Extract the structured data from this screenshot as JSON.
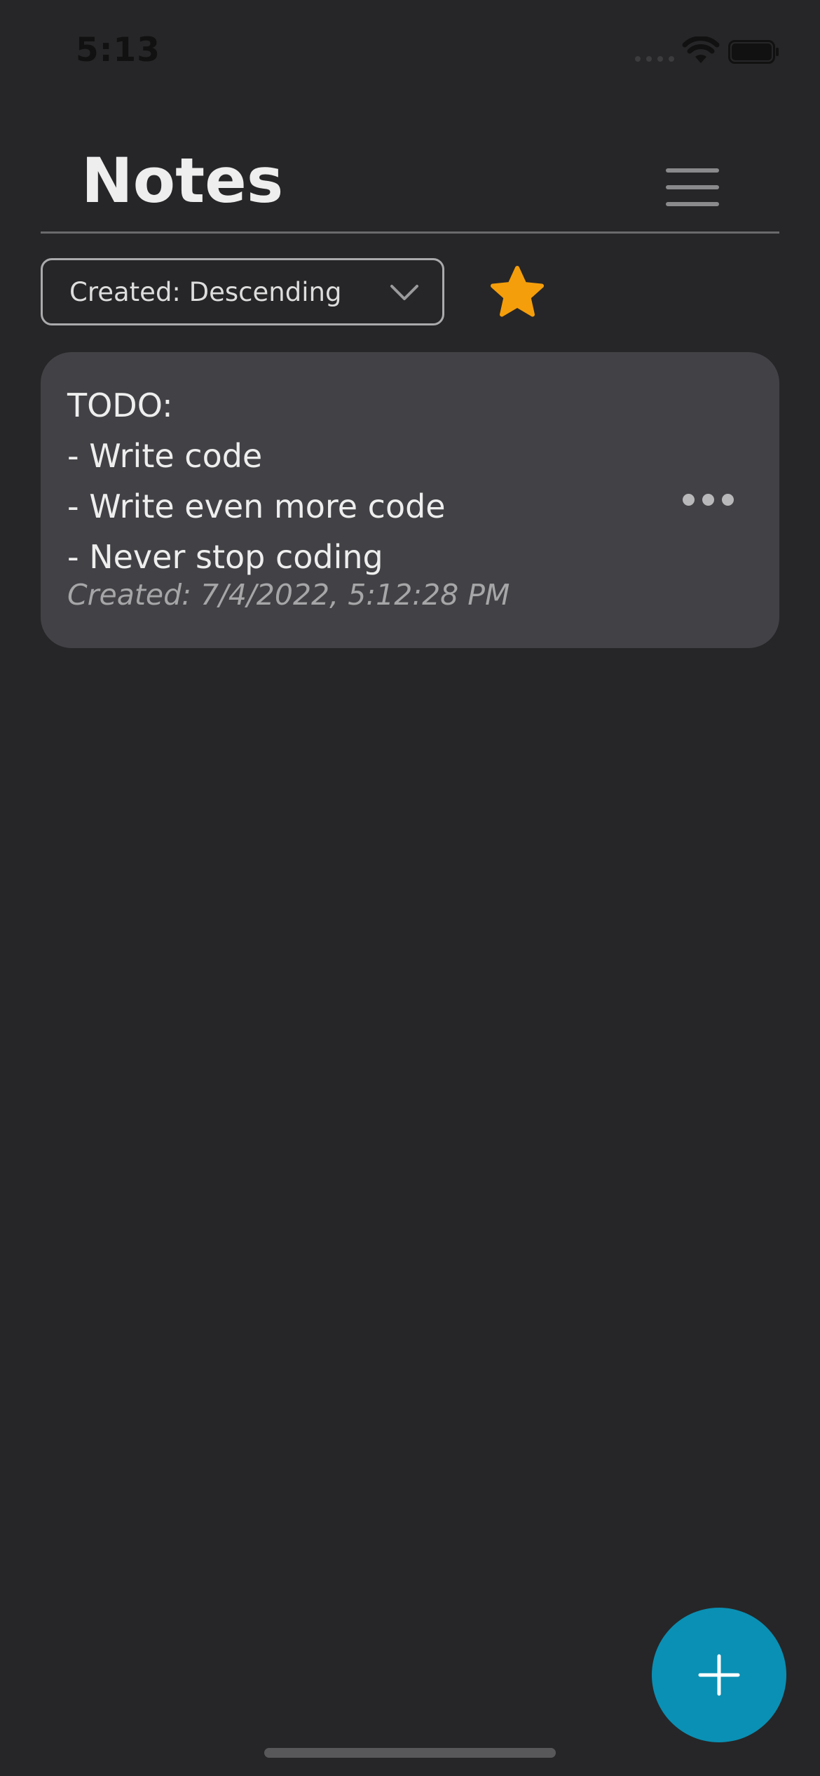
{
  "status_bar": {
    "time": "5:13",
    "icons": [
      "signal-icon",
      "wifi-icon",
      "battery-icon"
    ]
  },
  "header": {
    "title": "Notes",
    "menu_icon": "hamburger-menu-icon"
  },
  "sort": {
    "selected": "Created: Descending",
    "icon": "chevron-down-icon"
  },
  "favorites_filter": {
    "icon": "star-icon",
    "color": "#F59E0B"
  },
  "notes": [
    {
      "lines": [
        "TODO:",
        "- Write code",
        "- Write even more code",
        "- Never stop coding"
      ],
      "created": "Created: 7/4/2022, 5:12:28 PM",
      "menu_icon": "more-horizontal-icon"
    }
  ],
  "fab": {
    "icon": "plus-icon",
    "color": "#0A90B4"
  }
}
